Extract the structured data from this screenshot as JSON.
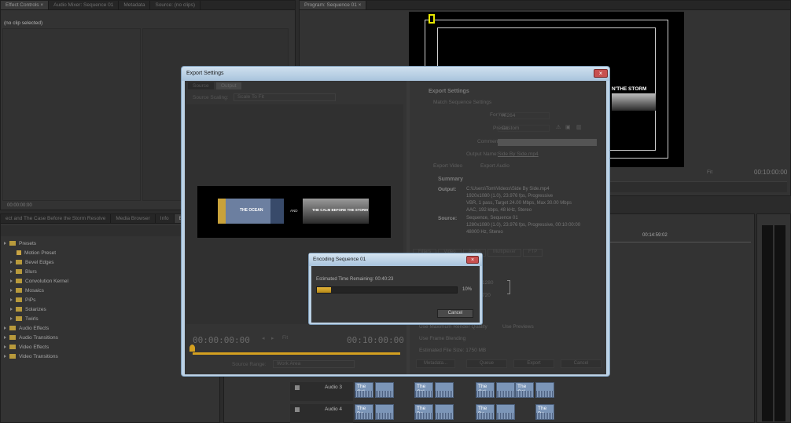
{
  "source_panel": {
    "tabs": [
      "Effect Controls ×",
      "Audio Mixer: Sequence 01",
      "Metadata",
      "Source: (no clips)"
    ],
    "no_clip_label": "(no clip selected)",
    "timecode": "00:00:00:00"
  },
  "program_panel": {
    "tab": "Program: Sequence 01 ×",
    "monitor_text": "N'THE STORM",
    "fit_label": "Fit",
    "timecode": "00:10:00:00"
  },
  "effects_panel": {
    "tabs": [
      "ect and The Case Before the Storm Resolve",
      "Media Browser",
      "Info",
      "Effects"
    ],
    "items": [
      {
        "label": "Presets",
        "level": 0,
        "folder": true
      },
      {
        "label": "Motion Preset",
        "level": 1,
        "folder": false
      },
      {
        "label": "Bevel Edges",
        "level": 1,
        "folder": true
      },
      {
        "label": "Blurs",
        "level": 1,
        "folder": true
      },
      {
        "label": "Convolution Kernel",
        "level": 1,
        "folder": true
      },
      {
        "label": "Mosaics",
        "level": 1,
        "folder": true
      },
      {
        "label": "PiPs",
        "level": 1,
        "folder": true
      },
      {
        "label": "Solarizes",
        "level": 1,
        "folder": true
      },
      {
        "label": "Twirls",
        "level": 1,
        "folder": true
      },
      {
        "label": "Audio Effects",
        "level": 0,
        "folder": true
      },
      {
        "label": "Audio Transitions",
        "level": 0,
        "folder": true
      },
      {
        "label": "Video Effects",
        "level": 0,
        "folder": true
      },
      {
        "label": "Video Transitions",
        "level": 0,
        "folder": true
      }
    ]
  },
  "timeline": {
    "ruler_time": "00:14:59:02",
    "tracks": [
      {
        "label": "Audio 3",
        "clip_label": "The Cal"
      },
      {
        "label": "Audio 4",
        "clip_label": "The De"
      }
    ]
  },
  "export_dialog": {
    "title": "Export Settings",
    "tabs": [
      "Source",
      "Output"
    ],
    "source_scaling_label": "Source Scaling:",
    "source_scaling_value": "Scale To Fit",
    "preview_left_text": "THE OCEAN",
    "preview_and": "AND",
    "preview_right_text": "THE CALM BEFORE THE STORM",
    "timecode_start": "00:00:00:00",
    "timecode_end": "00:10:00:00",
    "fit_label": "Fit",
    "source_range_label": "Source Range:",
    "source_range_value": "Work Area",
    "export_settings_header": "Export Settings",
    "match_sequence_label": "Match Sequence Settings",
    "format_label": "Format:",
    "format_value": "H.264",
    "preset_label": "Preset:",
    "preset_value": "Custom",
    "comments_label": "Comments:",
    "output_name_label": "Output Name:",
    "output_name_value": "Side By Side.mp4",
    "export_video_label": "Export Video",
    "export_audio_label": "Export Audio",
    "summary_header": "Summary",
    "output_label": "Output:",
    "output_lines": [
      "C:\\Users\\Tom\\Videos\\Side By Side.mp4",
      "1920x1080 (1.0), 23.976 fps, Progressive",
      "VBR, 1 pass, Target 24.00 Mbps, Max 30.00 Mbps",
      "AAC, 192 kbps, 48 kHz, Stereo"
    ],
    "source_label": "Source:",
    "source_lines": [
      "Sequence, Sequence 01",
      "1280x1080 (1.0), 23.976 fps, Progressive, 00:10:00:00",
      "48000 Hz, Stereo"
    ],
    "lower_tabs": [
      "Filters",
      "Video",
      "Audio",
      "Multiplexer",
      "FTP"
    ],
    "value_1280": "1280",
    "value_720": "720",
    "use_max_render_label": "Use Maximum Render Quality",
    "use_previews_label": "Use Previews",
    "use_frame_blending_label": "Use Frame Blending",
    "est_file_size": "Estimated File Size: 1750 MB",
    "buttons": {
      "metadata": "Metadata...",
      "queue": "Queue",
      "export": "Export",
      "cancel": "Cancel"
    }
  },
  "encoding_dialog": {
    "title": "Encoding Sequence 01",
    "time_remaining": "Estimated Time Remaining:  00:40:23",
    "progress_percent": 10,
    "percent_label": "10%",
    "cancel_label": "Cancel"
  },
  "colors": {
    "panel": "#333333",
    "accent_orange": "#d4a020",
    "dialog_frame": "#a9c4dd",
    "close_red": "#c75050",
    "clip_blue": "#7c96b8"
  }
}
